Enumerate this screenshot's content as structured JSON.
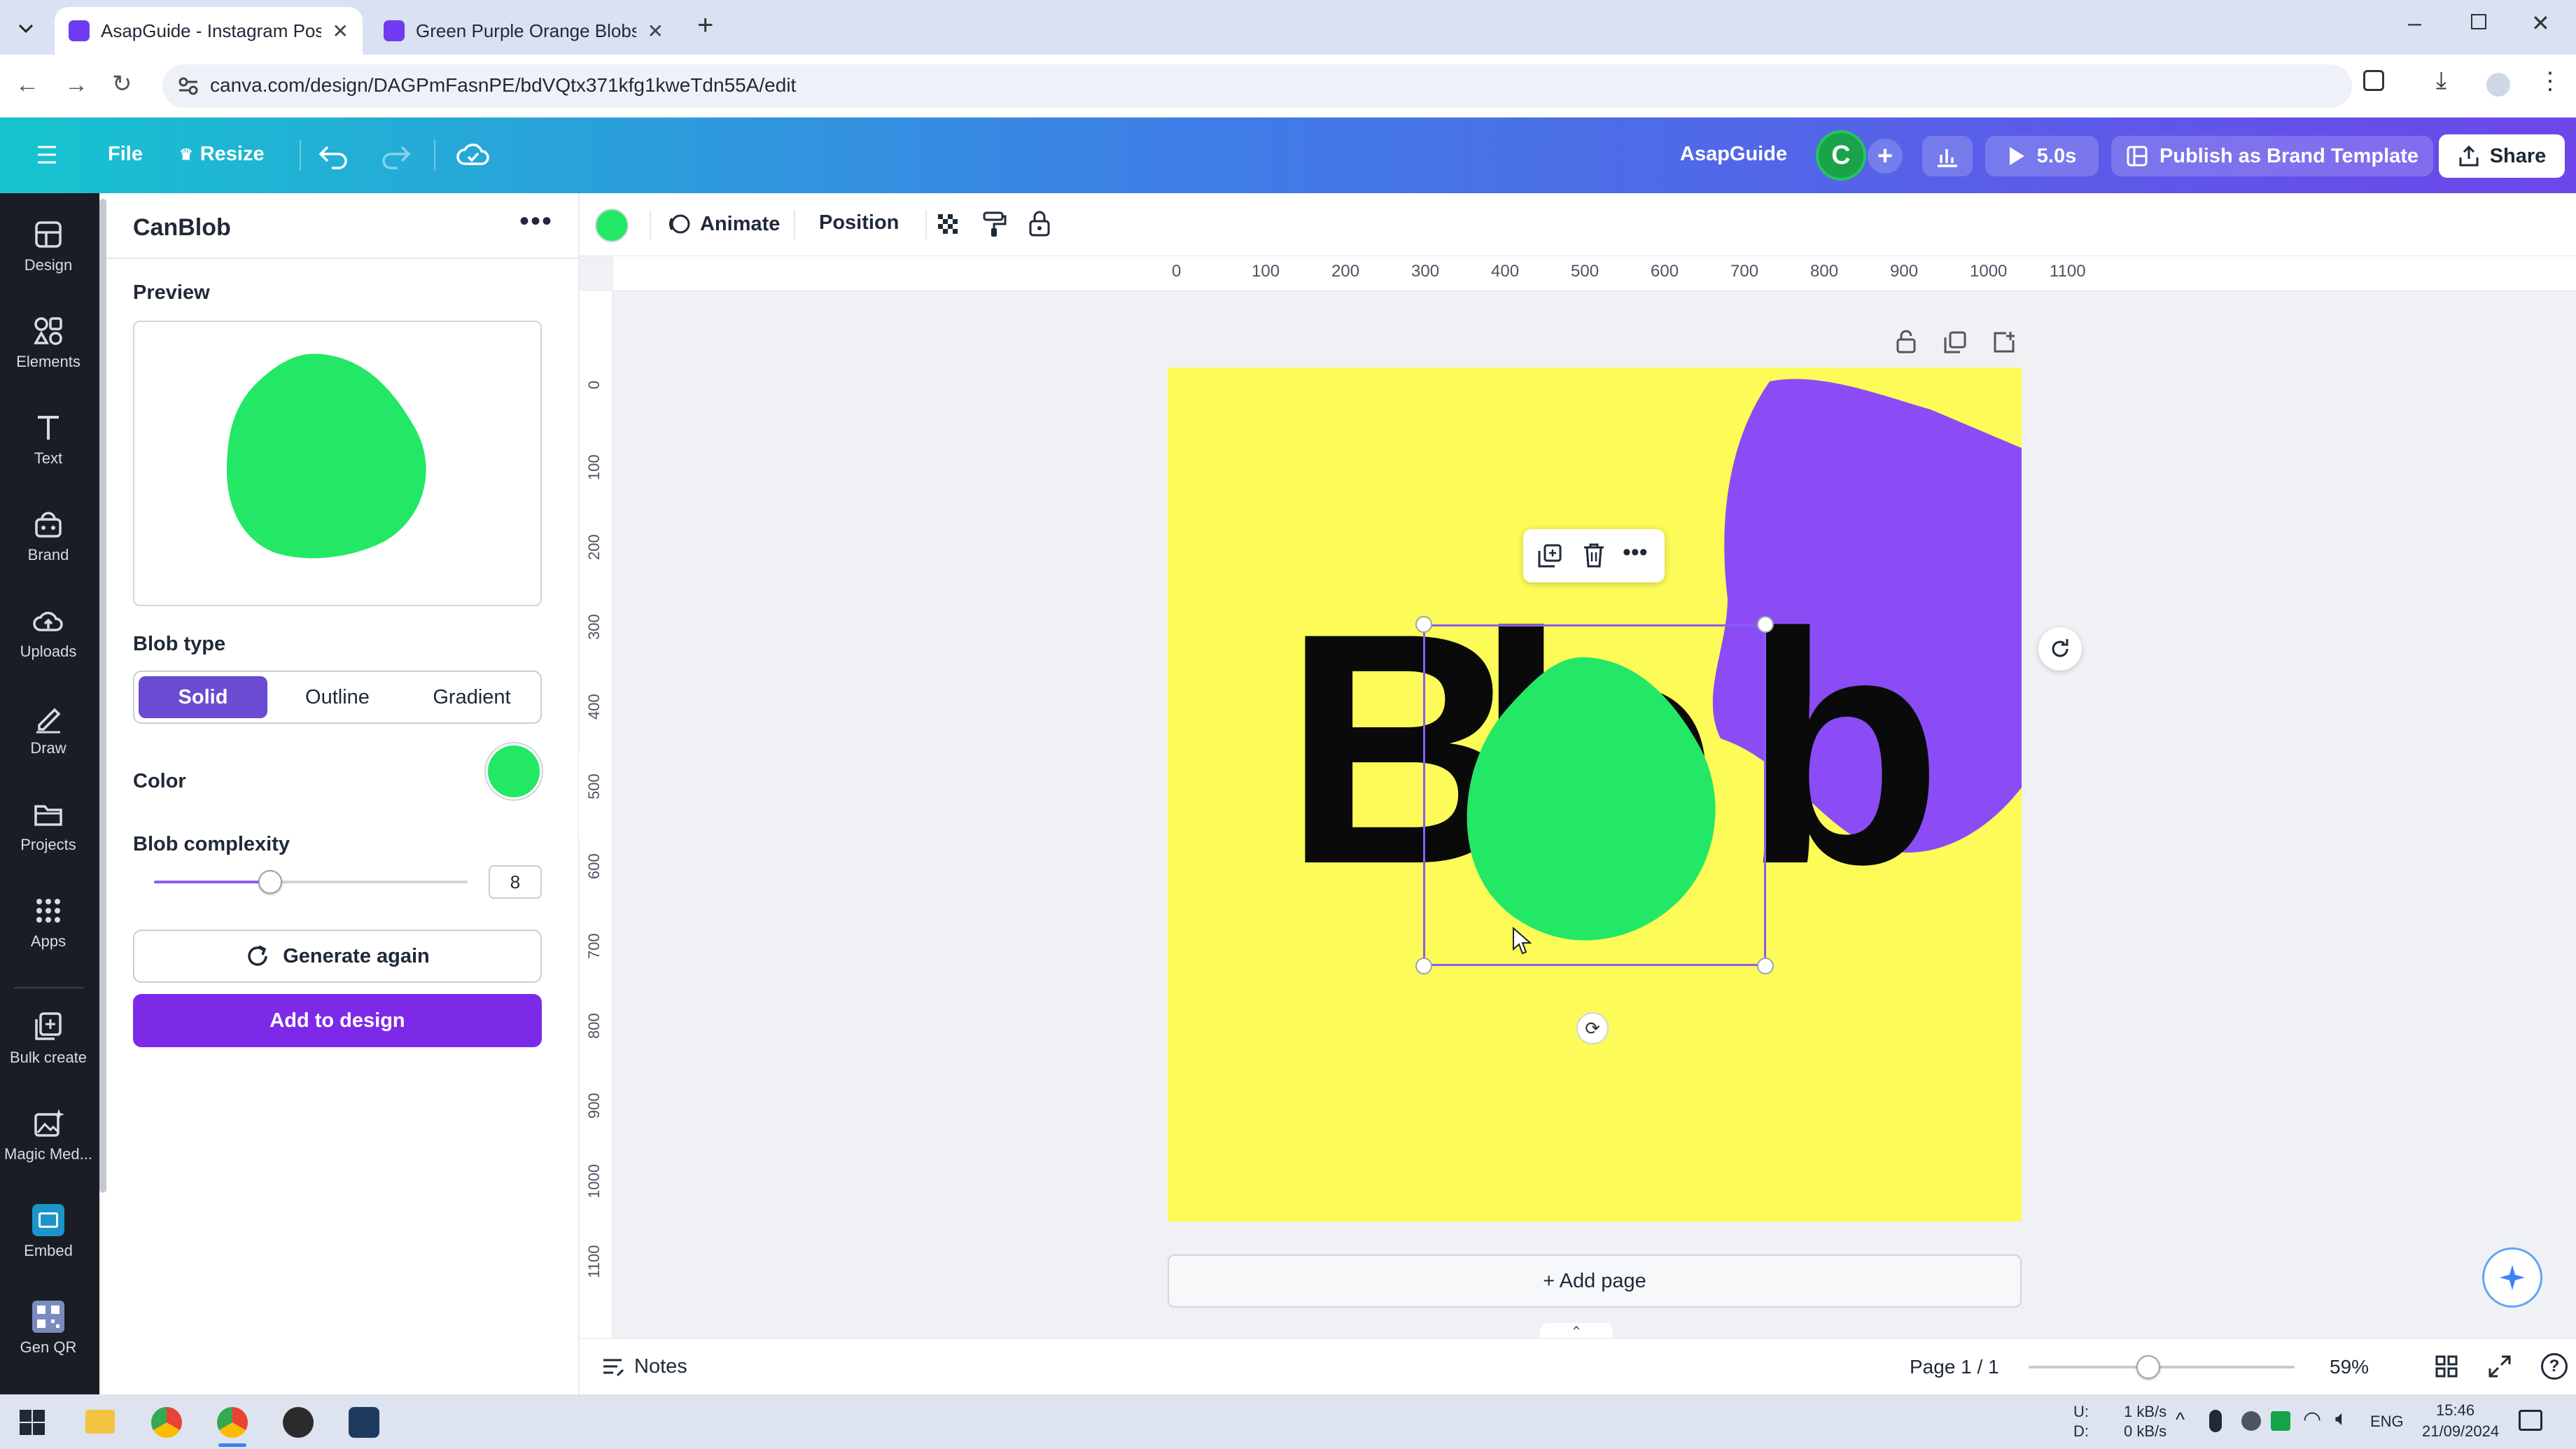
{
  "browser": {
    "tabs": [
      {
        "title": "AsapGuide - Instagram Post",
        "active": true
      },
      {
        "title": "Green Purple Orange Blobs Ba",
        "active": false
      }
    ],
    "url": "canva.com/design/DAGPmFasnPE/bdVQtx371kfg1kweTdn55A/edit"
  },
  "header": {
    "file_label": "File",
    "resize_label": "Resize",
    "team_name": "AsapGuide",
    "avatar_letter": "C",
    "play_duration": "5.0s",
    "publish_label": "Publish as Brand Template",
    "share_label": "Share"
  },
  "rail": {
    "items": [
      {
        "label": "Design",
        "icon": "design-icon"
      },
      {
        "label": "Elements",
        "icon": "elements-icon"
      },
      {
        "label": "Text",
        "icon": "text-icon"
      },
      {
        "label": "Brand",
        "icon": "brand-icon"
      },
      {
        "label": "Uploads",
        "icon": "uploads-icon"
      },
      {
        "label": "Draw",
        "icon": "draw-icon"
      },
      {
        "label": "Projects",
        "icon": "projects-icon"
      },
      {
        "label": "Apps",
        "icon": "apps-icon"
      },
      {
        "label": "Bulk create",
        "icon": "bulk-create-icon"
      },
      {
        "label": "Magic Med...",
        "icon": "magic-media-icon"
      },
      {
        "label": "Embed",
        "icon": "embed-icon"
      },
      {
        "label": "Gen QR",
        "icon": "qr-icon"
      }
    ]
  },
  "panel": {
    "title": "CanBlob",
    "preview_label": "Preview",
    "blob_type_label": "Blob type",
    "blob_types": [
      "Solid",
      "Outline",
      "Gradient"
    ],
    "selected_blob_type": "Solid",
    "color_label": "Color",
    "color_value": "#22e866",
    "complexity_label": "Blob complexity",
    "complexity_value": "8",
    "complexity_fraction": 0.37,
    "generate_label": "Generate again",
    "add_label": "Add to design"
  },
  "toolbar": {
    "color_swatch": "#22e866",
    "animate_label": "Animate",
    "position_label": "Position"
  },
  "rulers": {
    "top_ticks": [
      "0",
      "100",
      "200",
      "300",
      "400",
      "500",
      "600",
      "700",
      "800",
      "900",
      "1000",
      "1100"
    ],
    "left_ticks": [
      "0",
      "100",
      "200",
      "300",
      "400",
      "500",
      "600",
      "700",
      "800",
      "900",
      "1000",
      "1100"
    ]
  },
  "canvas": {
    "page_bg": "#fcfb58",
    "text_letters": [
      "B",
      "l",
      "o",
      "b"
    ],
    "purple_blob": "#8b4cf6",
    "green_blob": "#22e866",
    "add_page_label": "+ Add page"
  },
  "bottom": {
    "notes_label": "Notes",
    "page_indicator": "Page 1 / 1",
    "zoom_label": "59%",
    "zoom_fraction": 0.45
  },
  "taskbar": {
    "net_up_label": "U:",
    "net_down_label": "D:",
    "net_up": "1 kB/s",
    "net_down": "0 kB/s",
    "language": "ENG",
    "time": "15:46",
    "date": "21/09/2024"
  }
}
